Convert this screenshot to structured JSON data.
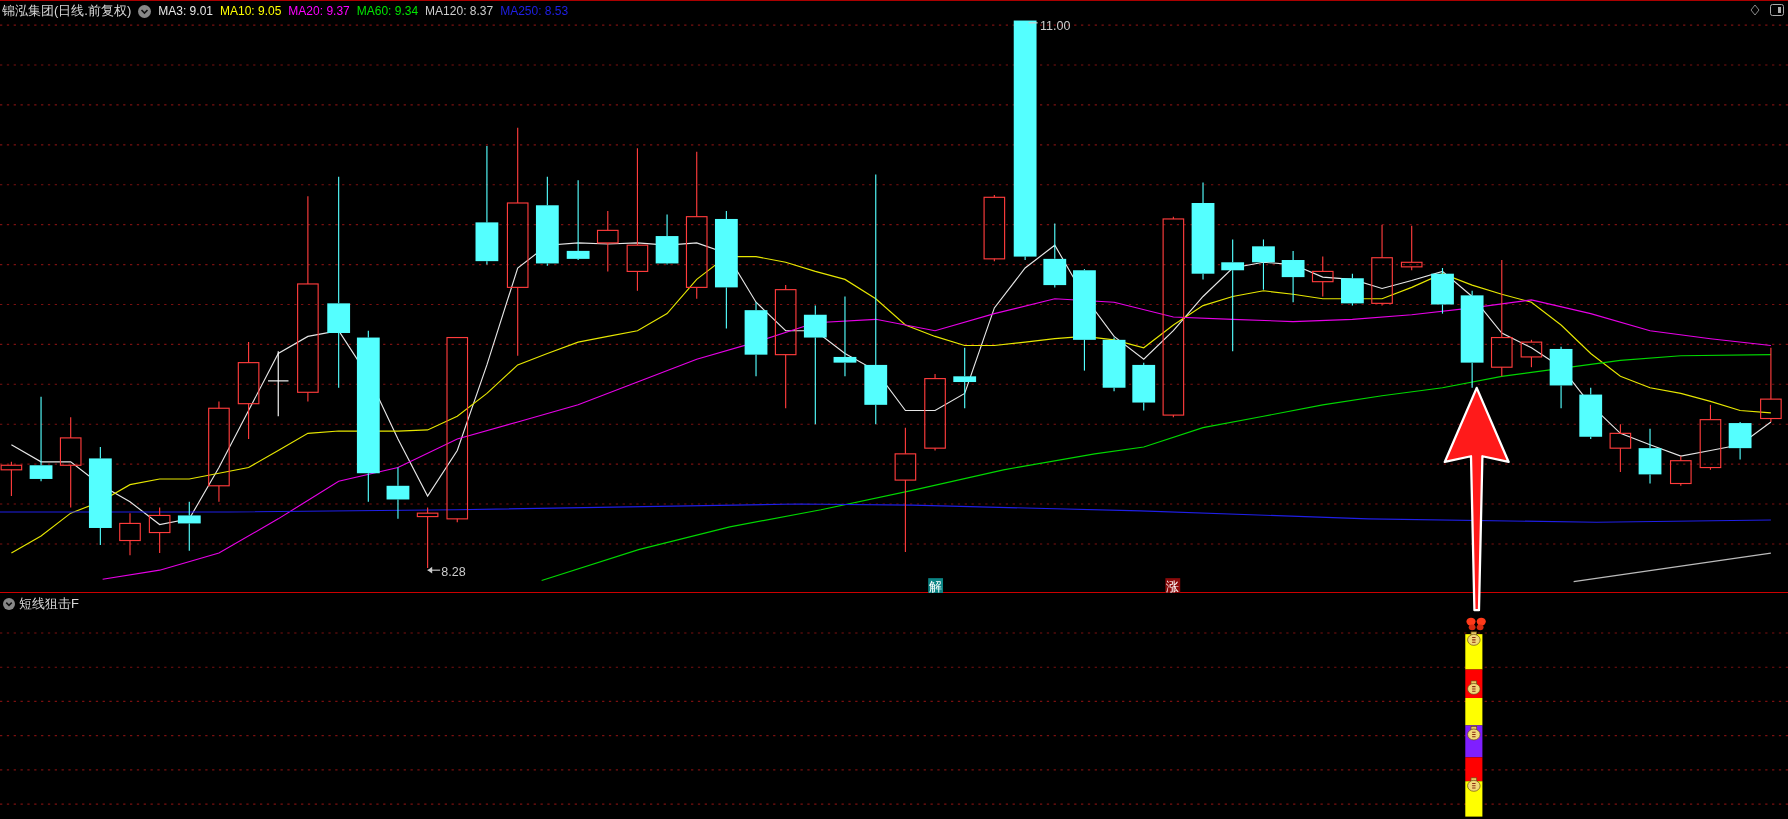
{
  "chart_header": {
    "title": "锦泓集团(日线.前复权)",
    "indicators": [
      {
        "label": "MA3: 9.01",
        "color": "#e6e6e6"
      },
      {
        "label": "MA10: 9.05",
        "color": "#ffff00"
      },
      {
        "label": "MA20: 9.37",
        "color": "#ff00ff"
      },
      {
        "label": "MA60: 9.34",
        "color": "#00e600"
      },
      {
        "label": "MA120: 8.37",
        "color": "#cccccc"
      },
      {
        "label": "MA250: 8.53",
        "color": "#1f1fe6"
      }
    ]
  },
  "price_labels": {
    "high": "11.00",
    "low": "8.28"
  },
  "markers": [
    {
      "text": "解",
      "color": "#0b8585"
    },
    {
      "text": "涨",
      "color": "#8b0a0a"
    }
  ],
  "indicator_panel": {
    "title": "短线狙击F",
    "segments": [
      {
        "color": "#ffff00"
      },
      {
        "color": "#ff0000"
      },
      {
        "color": "#ffff00"
      },
      {
        "color": "#7f1fff"
      },
      {
        "color": "#ff0000"
      },
      {
        "color": "#ffff00"
      }
    ]
  }
}
